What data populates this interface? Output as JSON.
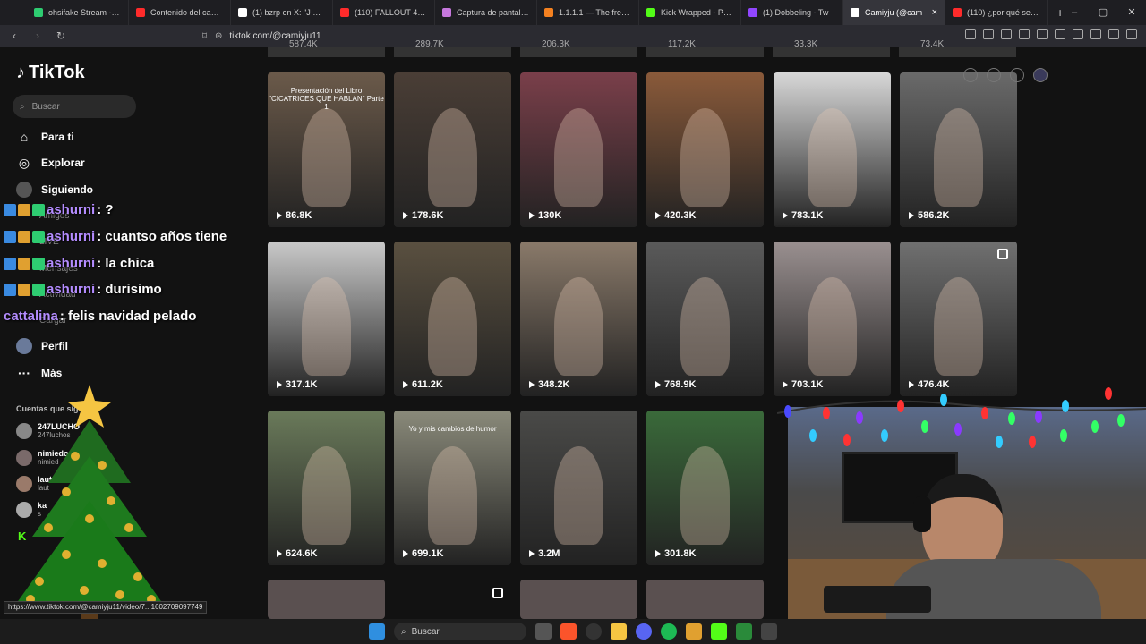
{
  "browser": {
    "tabs": [
      {
        "label": "ohsifake Stream - Wat",
        "color": "#2ecc71"
      },
      {
        "label": "Contenido del canal -",
        "color": "#ff2b2b"
      },
      {
        "label": "(1) bzrp en X: \"J BALVI",
        "color": "#ffffff"
      },
      {
        "label": "(110) FALLOUT 4 | PRI",
        "color": "#ff2b2b"
      },
      {
        "label": "Captura de pantalla p",
        "color": "#c678dd"
      },
      {
        "label": "1.1.1.1 — The free app",
        "color": "#f48120"
      },
      {
        "label": "Kick Wrapped - Proce",
        "color": "#53fc18"
      },
      {
        "label": "(1) Dobbeling - Tw",
        "color": "#9146ff"
      },
      {
        "label": "Camiyju (@cam",
        "color": "#ffffff",
        "active": true
      },
      {
        "label": "(110) ¿por qué se hace",
        "color": "#ff2b2b"
      }
    ],
    "new_tab": "+",
    "url": "tiktok.com/@camiyju11",
    "window_controls": [
      "–",
      "▢",
      "✕"
    ]
  },
  "sidebar": {
    "logo": "TikTok",
    "search_placeholder": "Buscar",
    "nav": [
      {
        "label": "Para ti",
        "icon": "home-icon",
        "glyph": "⌂"
      },
      {
        "label": "Explorar",
        "icon": "compass-icon",
        "glyph": "◎"
      },
      {
        "label": "Siguiendo",
        "icon": "following-icon",
        "glyph": "●"
      }
    ],
    "nav_lower": [
      {
        "label": "Perfil",
        "icon": "profile-icon",
        "glyph": "●"
      },
      {
        "label": "Más",
        "icon": "more-icon",
        "glyph": "···"
      }
    ],
    "ghost_items": [
      "Amigos",
      "LIVE",
      "Mensajes",
      "Actividad",
      "Cargar"
    ],
    "following_header": "Cuentas que sig",
    "following": [
      {
        "name": "247LUCHO",
        "sub": "247luchos"
      },
      {
        "name": "nimiedo",
        "sub": "nimied"
      },
      {
        "name": "lautar",
        "sub": "laut"
      },
      {
        "name": "ka",
        "sub": "s"
      }
    ]
  },
  "chat": [
    {
      "user": "ashurni",
      "text": ": ?"
    },
    {
      "user": "ashurni",
      "text": ": cuantso años tiene"
    },
    {
      "user": "ashurni",
      "text": ": la chica"
    },
    {
      "user": "ashurni",
      "text": ": durisimo"
    },
    {
      "user": "cattalina",
      "text": ": felis navidad pelado"
    }
  ],
  "top_row_partial": [
    "587.4K",
    "289.7K",
    "206.3K",
    "117.2K",
    "33.3K",
    "73.4K"
  ],
  "videos": [
    {
      "views": "86.8K",
      "caption": "Presentación del Libro \"CICATRICES QUE HABLAN\" Parte 1",
      "bg": "#6b5a4a"
    },
    {
      "views": "178.6K",
      "caption": "",
      "bg": "#4a3e36"
    },
    {
      "views": "130K",
      "caption": "",
      "bg": "#7a3f4a"
    },
    {
      "views": "420.3K",
      "caption": "",
      "bg": "#8a5a3a"
    },
    {
      "views": "783.1K",
      "caption": "",
      "bg": "#d8d8d8"
    },
    {
      "views": "586.2K",
      "caption": "",
      "bg": "#6a6a6a"
    },
    {
      "views": "317.1K",
      "caption": "",
      "bg": "#c9c9c9"
    },
    {
      "views": "611.2K",
      "caption": "",
      "bg": "#5a5040"
    },
    {
      "views": "348.2K",
      "caption": "",
      "bg": "#8a7a6a"
    },
    {
      "views": "768.9K",
      "caption": "",
      "bg": "#5a5a5a"
    },
    {
      "views": "703.1K",
      "caption": "",
      "bg": "#9a9090"
    },
    {
      "views": "476.4K",
      "caption": "",
      "bg": "#707070"
    },
    {
      "views": "624.6K",
      "caption": "",
      "bg": "#6a7a5a"
    },
    {
      "views": "699.1K",
      "caption": "Yo y mis cambios de humor",
      "bg": "#8a8a7a"
    },
    {
      "views": "3.2M",
      "caption": "",
      "bg": "#4a4a48"
    },
    {
      "views": "301.8K",
      "caption": "",
      "bg": "#3a6a3a"
    }
  ],
  "status_url": "https://www.tiktok.com/@camiyju11/video/7...1602709097749",
  "taskbar": {
    "search_placeholder": "Buscar"
  }
}
